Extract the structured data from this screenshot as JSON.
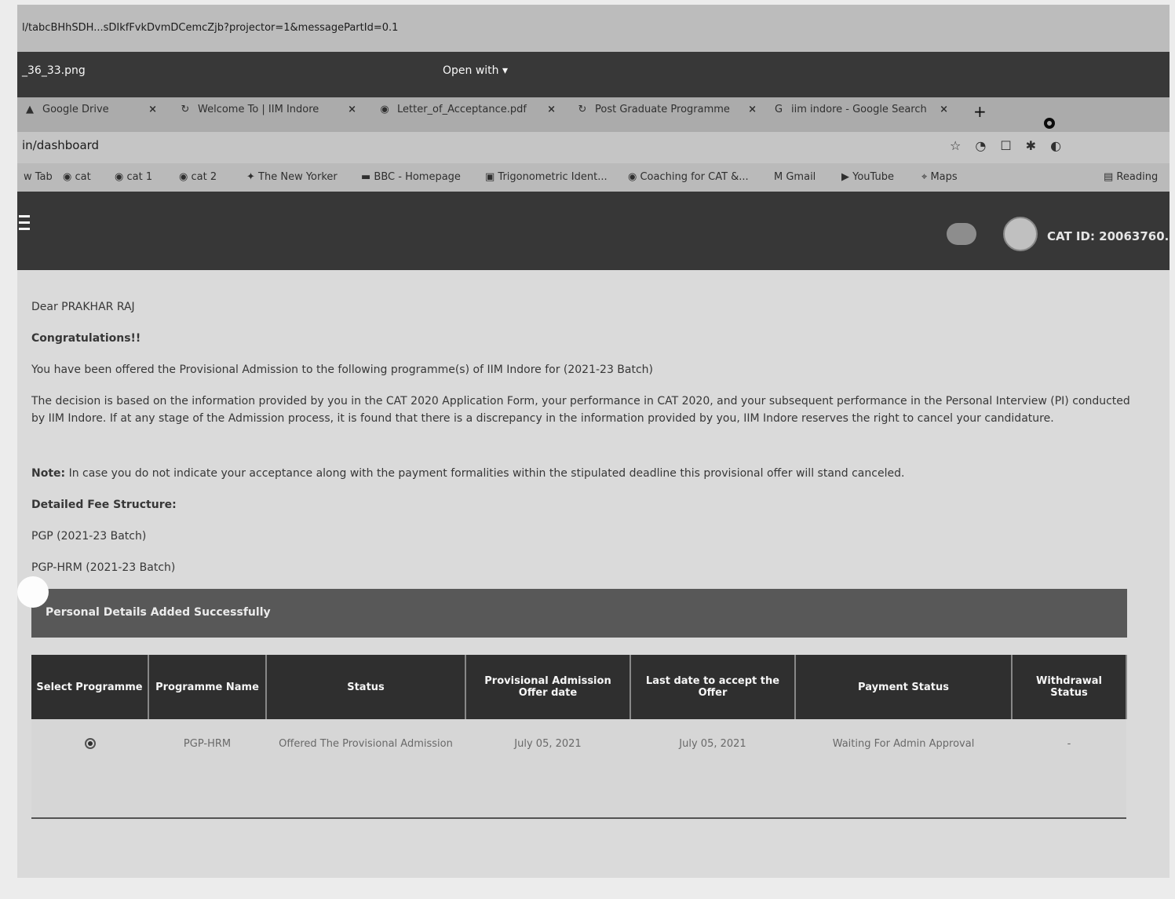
{
  "browser": {
    "top_url": "l/tabcBHhSDH...sDIkfFvkDvmDCemcZjb?projector=1&messagePartId=0.1",
    "viewer_filename": "_36_33.png",
    "open_with": "Open with ▾",
    "tabs": [
      {
        "label": "Google Drive",
        "icon": "drive-icon"
      },
      {
        "label": "Welcome To | IIM Indore",
        "icon": "page-icon"
      },
      {
        "label": "Letter_of_Acceptance.pdf",
        "icon": "globe-icon"
      },
      {
        "label": "Post Graduate Programme",
        "icon": "page-icon"
      },
      {
        "label": "iim indore - Google Search",
        "icon": "google-icon"
      }
    ],
    "new_tab": "+",
    "address": "in/dashboard",
    "bookmarks": [
      {
        "label": "w Tab"
      },
      {
        "label": "cat"
      },
      {
        "label": "cat 1"
      },
      {
        "label": "cat 2"
      },
      {
        "label": "The New Yorker"
      },
      {
        "label": "BBC - Homepage"
      },
      {
        "label": "Trigonometric Ident..."
      },
      {
        "label": "Coaching for CAT &..."
      },
      {
        "label": "Gmail"
      },
      {
        "label": "YouTube"
      },
      {
        "label": "Maps"
      },
      {
        "label": "Reading"
      }
    ]
  },
  "header": {
    "cat_id": "CAT ID: 20063760..."
  },
  "letter": {
    "greeting": "Dear PRAKHAR RAJ",
    "congrats": "Congratulations!!",
    "offer": "You have been offered the Provisional Admission to the following programme(s) of IIM Indore for (2021-23 Batch)",
    "decision": "The decision is based on the information provided by you in the CAT 2020 Application Form, your performance in CAT 2020, and your subsequent performance in the Personal Interview (PI) conducted by IIM Indore. If at any stage of the Admission process, it is found that there is a discrepancy in the information provided by you, IIM Indore reserves the right to cancel your candidature.",
    "note_label": "Note:",
    "note": "In case you do not indicate your acceptance along with the payment formalities within the stipulated deadline this provisional offer will stand canceled.",
    "fee_heading": "Detailed Fee Structure:",
    "fee_links": [
      "PGP (2021-23 Batch)",
      "PGP-HRM (2021-23 Batch)"
    ]
  },
  "banner": "Personal Details Added Successfully",
  "table": {
    "headers": [
      "Select Programme",
      "Programme Name",
      "Status",
      "Provisional Admission Offer date",
      "Last date to accept the Offer",
      "Payment Status",
      "Withdrawal Status"
    ],
    "row": {
      "programme": "PGP-HRM",
      "status": "Offered The Provisional Admission",
      "offer_date": "July 05, 2021",
      "last_date": "July 05, 2021",
      "payment": "Waiting For Admin Approval",
      "withdrawal": "-"
    }
  }
}
